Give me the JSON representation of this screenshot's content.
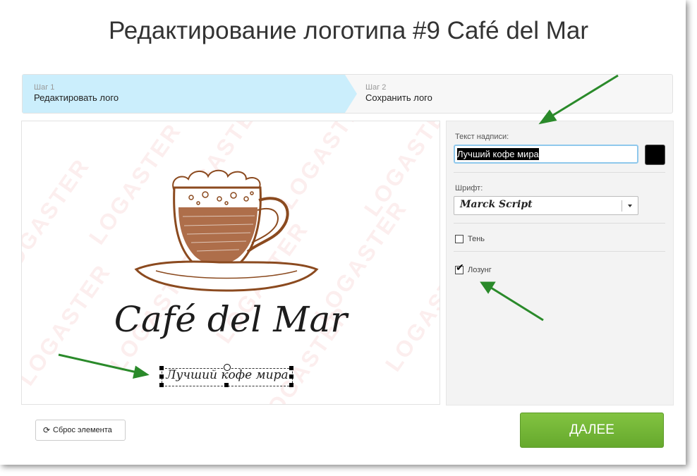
{
  "page": {
    "title": "Редактирование логотипа #9 Café del Mar"
  },
  "steps": [
    {
      "num": "Шаг 1",
      "label": "Редактировать лого"
    },
    {
      "num": "Шаг 2",
      "label": "Сохранить лого"
    }
  ],
  "canvas": {
    "watermark": "LOGASTER",
    "brand_name": "Café del Mar",
    "slogan": "Лучший кофе мира"
  },
  "panel": {
    "text_label": "Текст надписи:",
    "text_value": "Лучший кофе мира",
    "text_color": "#000000",
    "font_label": "Шрифт:",
    "font_value": "Marck Script",
    "shadow_label": "Тень",
    "shadow_checked": false,
    "slogan_label": "Лозунг",
    "slogan_checked": true
  },
  "buttons": {
    "reset_label": "Сброс элемента",
    "next_label": "ДАЛЕЕ"
  },
  "colors": {
    "accent_step": "#cbeefc",
    "next_button": "#72b437",
    "cup": "#8b4a1f",
    "arrow": "#2a8a2a"
  },
  "icons": [
    "refresh-icon",
    "chevron-down-icon",
    "checkmark-icon"
  ]
}
